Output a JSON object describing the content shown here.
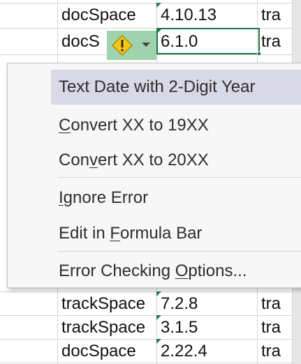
{
  "rows": [
    {
      "b": "docSpace",
      "c": "4.10.13",
      "d": "tra"
    },
    {
      "b": "docS",
      "c": "6.1.0",
      "d": "tra"
    },
    {
      "b": "trackSpace",
      "c": "7.2.8",
      "d": "tra"
    },
    {
      "b": "trackSpace",
      "c": "3.1.5",
      "d": "tra"
    },
    {
      "b": "docSpace",
      "c": "2.22.4",
      "d": "tra"
    }
  ],
  "smart_tag": {
    "icon": "warning-icon",
    "color": "#f2c811"
  },
  "menu": {
    "header": "Text Date with 2-Digit Year",
    "convert19": {
      "pre": "",
      "key": "C",
      "post": "onvert XX to 19XX"
    },
    "convert20": {
      "pre": "Con",
      "key": "v",
      "post": "ert XX to 20XX"
    },
    "ignore": {
      "pre": "",
      "key": "I",
      "post": "gnore Error"
    },
    "formula": {
      "pre": "Edit in ",
      "key": "F",
      "post": "ormula Bar"
    },
    "options": {
      "pre": "Error Checking ",
      "key": "O",
      "post": "ptions..."
    }
  },
  "colors": {
    "accent": "#1e7145",
    "smart_tag_bg": "#9ed3ad",
    "hover": "#d8d8e6"
  }
}
